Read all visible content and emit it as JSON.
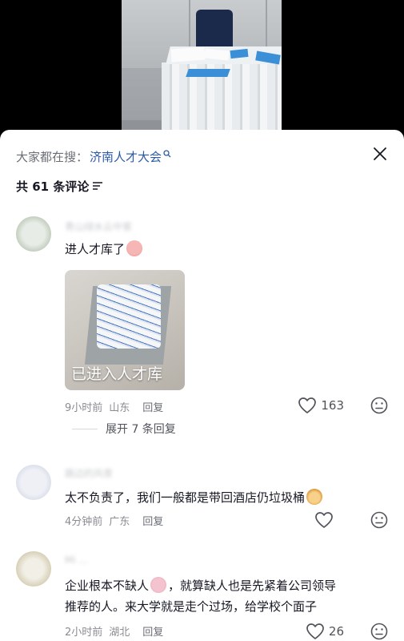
{
  "sheet": {
    "search_prefix": "大家都在搜：",
    "search_term": "济南人才大会",
    "comment_count": "共 61 条评论"
  },
  "comments": [
    {
      "username": "青山绿水云中客",
      "text": "进人才库了",
      "emoji": "pig-face-emoji",
      "image_caption": "已进入人才库",
      "time": "9小时前",
      "location": "山东",
      "reply_label": "回复",
      "likes": "163",
      "expand_label": "展开 7 条回复"
    },
    {
      "username": "路边的风景",
      "text": "太不负责了，我们一般都是带回酒店仍垃圾桶",
      "emoji": "monkey-face-emoji",
      "time": "4分钟前",
      "location": "广东",
      "reply_label": "回复",
      "likes": ""
    },
    {
      "username": "Mi ...",
      "text_line1": "企业根本不缺人",
      "text_line1_rest": "，就算缺人也是先紧着公司领导",
      "text_line2": "推荐的人。来大学就是走个过场，给学校个面子",
      "emoji": "crying-face-emoji",
      "time": "2小时前",
      "location": "湖北",
      "reply_label": "回复",
      "likes": "26"
    }
  ],
  "colors": {
    "accent_link": "#2b5aa8",
    "text_primary": "#161823",
    "text_secondary": "#8a8c92"
  }
}
